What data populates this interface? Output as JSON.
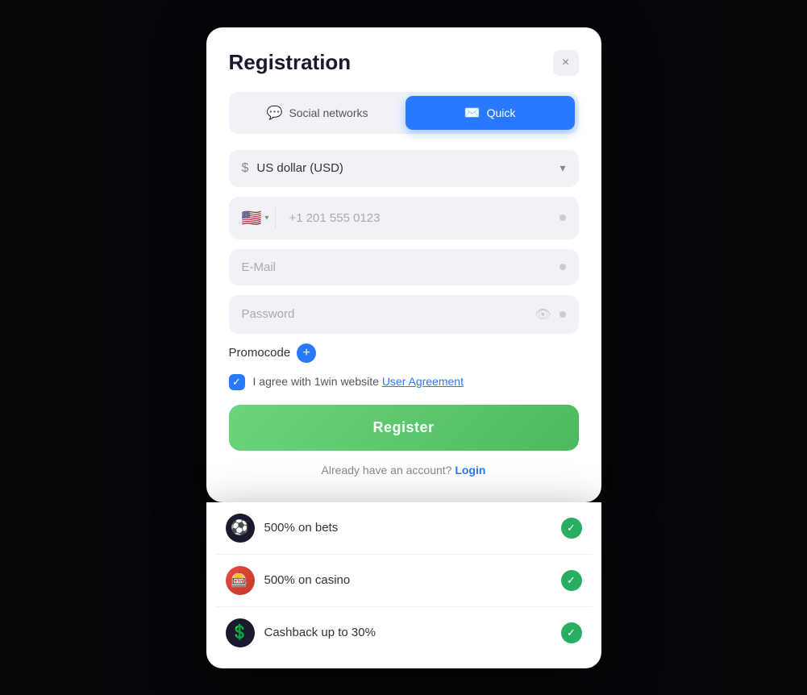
{
  "modal": {
    "title": "Registration",
    "close_label": "×",
    "tabs": [
      {
        "id": "social",
        "label": "Social networks",
        "icon": "💬",
        "active": false
      },
      {
        "id": "quick",
        "label": "Quick",
        "icon": "✉️",
        "active": true
      }
    ],
    "currency_field": {
      "placeholder": "US dollar (USD)",
      "icon": "$"
    },
    "phone_field": {
      "flag": "🇺🇸",
      "placeholder": "+1 201 555 0123"
    },
    "email_field": {
      "placeholder": "E-Mail"
    },
    "password_field": {
      "placeholder": "Password"
    },
    "promocode": {
      "label": "Promocode",
      "add_icon": "+"
    },
    "agreement": {
      "text_before": "I agree with 1win website ",
      "link_text": "User Agreement"
    },
    "register_button": "Register",
    "login_row": {
      "text": "Already have an account?",
      "link": "Login"
    }
  },
  "bonuses": [
    {
      "id": "bets",
      "icon": "⚽",
      "icon_style": "dark",
      "text": "500% on bets"
    },
    {
      "id": "casino",
      "icon": "🎰",
      "icon_style": "casino",
      "text": "500% on casino"
    },
    {
      "id": "cashback",
      "icon": "💲",
      "icon_style": "cashback",
      "text": "Cashback up to 30%"
    }
  ]
}
